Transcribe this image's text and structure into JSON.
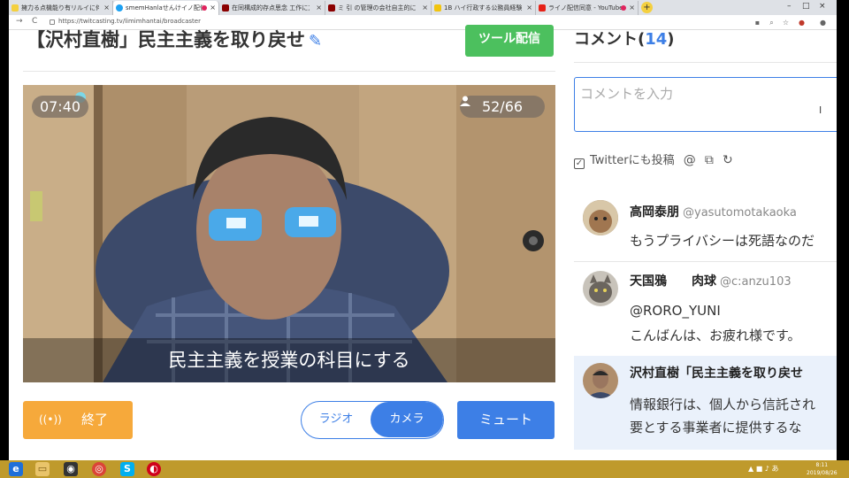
{
  "browser": {
    "tabs": [
      {
        "title": "擁力る点機能り有リルイに何者るか！",
        "color": "#f4d03f",
        "active": false,
        "recording": false
      },
      {
        "title": "smemHanlaせんけイノ配信",
        "color": "#1da1f2",
        "active": true,
        "recording": true
      },
      {
        "title": "在同構成的存点思念 工作に方法",
        "color": "#8b0000",
        "active": false,
        "recording": false
      },
      {
        "title": "ミ 引 の管理の会社自主的に",
        "color": "#8b0000",
        "active": false,
        "recording": false
      },
      {
        "title": "1B ハイ行政する公務員経験 ノー",
        "color": "#f1c40f",
        "active": false,
        "recording": false
      },
      {
        "title": "ライノ配信同意 - YouTube",
        "color": "#e62117",
        "active": false,
        "recording": true
      }
    ],
    "new_tab": "+",
    "window_controls": {
      "minimize": "–",
      "maximize": "□",
      "close": "×"
    },
    "back": "←",
    "forward": "→",
    "reload": "C",
    "url": "https://twitcasting.tv/limimhantai/broadcaster"
  },
  "page": {
    "title": "【沢村直樹」民主主義を取り戻せ",
    "edit_icon": "pencil-icon",
    "tool_button": "ツール配信"
  },
  "video": {
    "elapsed": "07:40",
    "viewers": "52/66",
    "caption": "民主主義を授業の科目にする"
  },
  "controls": {
    "end_icon": "((•))",
    "end": "終了",
    "radio": "ラジオ",
    "camera": "カメラ",
    "mode_selected": "カメラ",
    "mute": "ミュート"
  },
  "comments_panel": {
    "heading": "コメント(",
    "count": "14",
    "heading_close": ")",
    "input_placeholder": "コメントを入力",
    "cursor": "I",
    "twitter_checked": true,
    "twitter_label": "Twitterにも投稿",
    "twitter_check": "✓",
    "icons": [
      "at-icon",
      "copy-icon",
      "refresh-icon"
    ],
    "at_symbol": "@",
    "copy_symbol": "⧉",
    "refresh_symbol": "↻"
  },
  "comments": [
    {
      "name": "高岡泰朋",
      "handle": "@yasutomotakaoka",
      "lines": [
        "もうプライバシーは死語なのだ"
      ],
      "highlight": false
    },
    {
      "name": "天国鴉　　肉球",
      "handle": "@c:anzu103",
      "lines": [
        "@RORO_YUNI",
        "こんばんは、お疲れ様です。"
      ],
      "highlight": false
    },
    {
      "name": "沢村直樹「民主主義を取り戻せ",
      "handle": "",
      "lines": [
        "情報銀行は、個人から信託され",
        "要とする事業者に提供するな"
      ],
      "highlight": true
    }
  ],
  "taskbar": {
    "tray_text": "▲ ■ ♪ あ",
    "clock_time": "8:11",
    "clock_date": "2019/08/26"
  },
  "colors": {
    "accent_blue": "#3d7fe6",
    "green": "#4cc05e",
    "orange": "#f6a93b",
    "taskbar": "#bf9a2c"
  }
}
